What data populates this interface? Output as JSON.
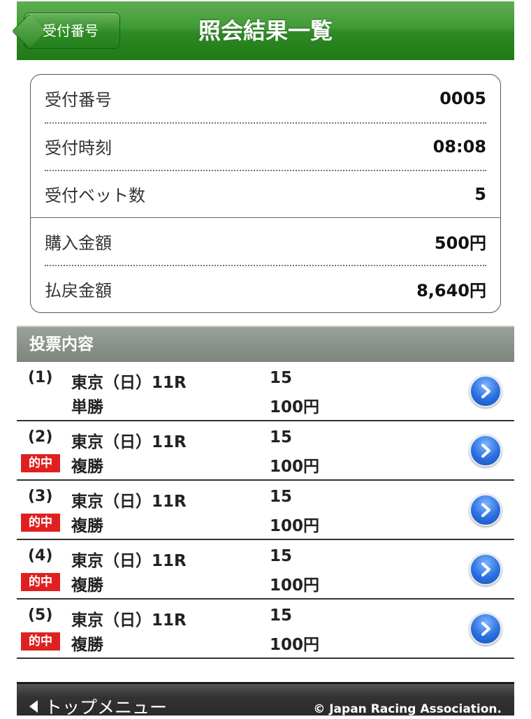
{
  "header": {
    "back_label": "受付番号",
    "title": "照会結果一覧"
  },
  "summary": {
    "receipt_number_label": "受付番号",
    "receipt_number": "0005",
    "receipt_time_label": "受付時刻",
    "receipt_time": "08:08",
    "bet_count_label": "受付ベット数",
    "bet_count": "5",
    "purchase_amount_label": "購入金額",
    "purchase_amount": "500円",
    "payout_amount_label": "払戻金額",
    "payout_amount": "8,640円"
  },
  "section": {
    "title": "投票内容"
  },
  "bets": [
    {
      "num": "(1)",
      "race": "東京（日）11R",
      "horse": "15",
      "type": "単勝",
      "amount": "100円",
      "hit": ""
    },
    {
      "num": "(2)",
      "race": "東京（日）11R",
      "horse": "15",
      "type": "複勝",
      "amount": "100円",
      "hit": "的中"
    },
    {
      "num": "(3)",
      "race": "東京（日）11R",
      "horse": "15",
      "type": "複勝",
      "amount": "100円",
      "hit": "的中"
    },
    {
      "num": "(4)",
      "race": "東京（日）11R",
      "horse": "15",
      "type": "複勝",
      "amount": "100円",
      "hit": "的中"
    },
    {
      "num": "(5)",
      "race": "東京（日）11R",
      "horse": "15",
      "type": "複勝",
      "amount": "100円",
      "hit": "的中"
    }
  ],
  "footer": {
    "top_menu_label": "トップメニュー",
    "copyright": "© Japan Racing Association."
  },
  "colors": {
    "header_green": "#2f8a24",
    "hit_red": "#e02020",
    "chevron_blue": "#2a6fe0"
  },
  "icons": {
    "back": "back-arrow-button",
    "row_action": "chevron-right-circle-icon",
    "footer_back": "left-triangle-icon"
  }
}
